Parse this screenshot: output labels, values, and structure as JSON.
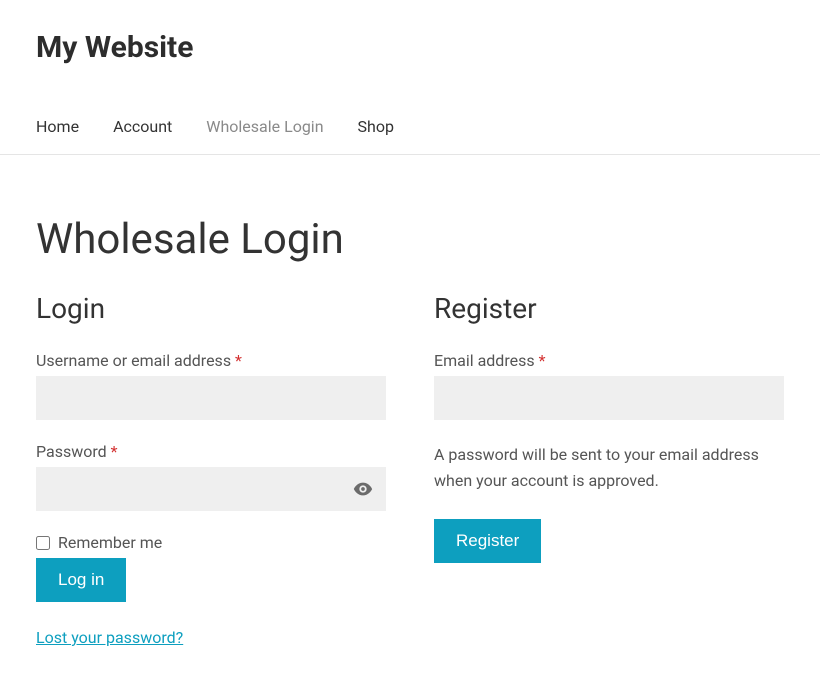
{
  "site": {
    "title": "My Website"
  },
  "nav": {
    "items": [
      {
        "label": "Home",
        "current": false
      },
      {
        "label": "Account",
        "current": false
      },
      {
        "label": "Wholesale Login",
        "current": true
      },
      {
        "label": "Shop",
        "current": false
      }
    ]
  },
  "page": {
    "title": "Wholesale Login"
  },
  "login": {
    "heading": "Login",
    "username_label": "Username or email address ",
    "password_label": "Password ",
    "remember_label": "Remember me",
    "submit_label": "Log in",
    "lost_password_label": "Lost your password?",
    "required_mark": "*"
  },
  "register": {
    "heading": "Register",
    "email_label": "Email address ",
    "helper_text": "A password will be sent to your email address when your account is approved.",
    "submit_label": "Register",
    "required_mark": "*"
  }
}
